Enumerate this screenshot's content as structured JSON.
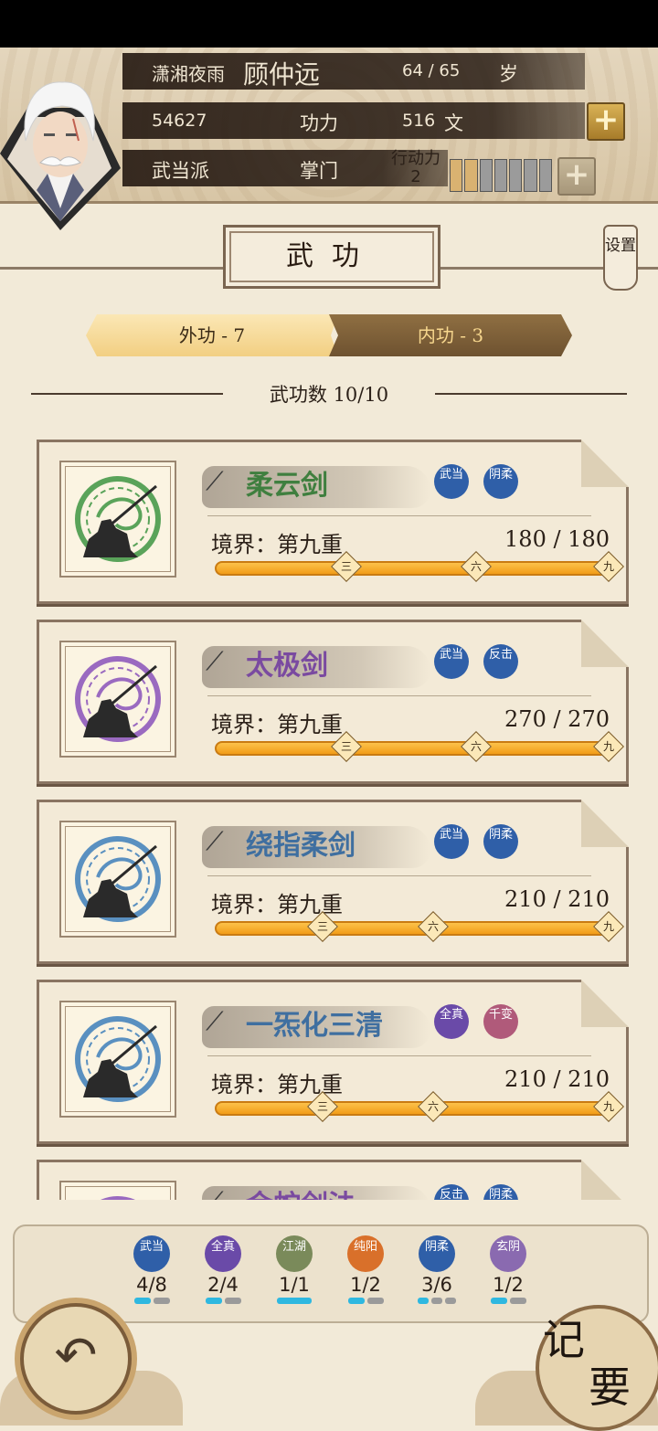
{
  "header": {
    "title": "潇湘夜雨",
    "name": "顾仲远",
    "age": "64 / 65",
    "age_label": "岁",
    "power_value": "54627",
    "power_label": "功力",
    "money": "516",
    "money_unit": "文",
    "sect": "武当派",
    "rank": "掌门",
    "action_label": "行动力",
    "action_value": "2",
    "stamina": {
      "filled": 2,
      "total": 7
    }
  },
  "page_title": "武功",
  "settings_label": "设置",
  "tabs": [
    {
      "label": "外功 - 7",
      "active": true
    },
    {
      "label": "内功 - 3",
      "active": false
    }
  ],
  "skill_count": "武功数 10/10",
  "skills": [
    {
      "name": "柔云剑",
      "name_color": "#3f7f3f",
      "emblem_color": "#5aa35a",
      "tags": [
        {
          "text": "武当",
          "color": "#2f5fa8"
        },
        {
          "text": "阴柔",
          "color": "#2f5fa8"
        }
      ],
      "realm": "境界：第九重",
      "progress": "180 / 180",
      "markers": [
        "三",
        "六",
        "九"
      ]
    },
    {
      "name": "太极剑",
      "name_color": "#7a4aa0",
      "emblem_color": "#9a6ac0",
      "tags": [
        {
          "text": "武当",
          "color": "#2f5fa8"
        },
        {
          "text": "反击",
          "color": "#2f5fa8"
        }
      ],
      "realm": "境界：第九重",
      "progress": "270 / 270",
      "markers": [
        "三",
        "六",
        "九"
      ]
    },
    {
      "name": "绕指柔剑",
      "name_color": "#3f6fa0",
      "emblem_color": "#5a90c0",
      "tags": [
        {
          "text": "武当",
          "color": "#2f5fa8"
        },
        {
          "text": "阴柔",
          "color": "#2f5fa8"
        }
      ],
      "realm": "境界：第九重",
      "progress": "210 / 210",
      "markers": [
        "三",
        "六",
        "九"
      ]
    },
    {
      "name": "一炁化三清",
      "name_color": "#3f6fa0",
      "emblem_color": "#5a90c0",
      "tags": [
        {
          "text": "全真",
          "color": "#6a4aa8"
        },
        {
          "text": "千变",
          "color": "#b05a7a"
        }
      ],
      "realm": "境界：第九重",
      "progress": "210 / 210",
      "markers": [
        "三",
        "六",
        "九"
      ]
    },
    {
      "name": "金蛇剑法",
      "name_color": "#7a4aa0",
      "emblem_color": "#9a6ac0",
      "tags": [
        {
          "text": "反击",
          "color": "#2f5fa8"
        },
        {
          "text": "阴柔",
          "color": "#2f5fa8"
        }
      ],
      "realm": "",
      "progress": "",
      "markers": []
    }
  ],
  "factions": [
    {
      "label": "武当",
      "count": "4/8",
      "color": "#2f5fa8",
      "filled": 1,
      "total": 2
    },
    {
      "label": "全真",
      "count": "2/4",
      "color": "#6a4aa8",
      "filled": 1,
      "total": 2
    },
    {
      "label": "江湖",
      "count": "1/1",
      "color": "#7a8a5a",
      "filled": 1,
      "total": 1
    },
    {
      "label": "纯阳",
      "count": "1/2",
      "color": "#d9702a",
      "filled": 1,
      "total": 2
    },
    {
      "label": "阴柔",
      "count": "3/6",
      "color": "#2f5fa8",
      "filled": 1,
      "total": 3
    },
    {
      "label": "玄阴",
      "count": "1/2",
      "color": "#8a6ab0",
      "filled": 1,
      "total": 2
    }
  ],
  "back_icon": "back-arrow-icon",
  "memo_label": "记要"
}
